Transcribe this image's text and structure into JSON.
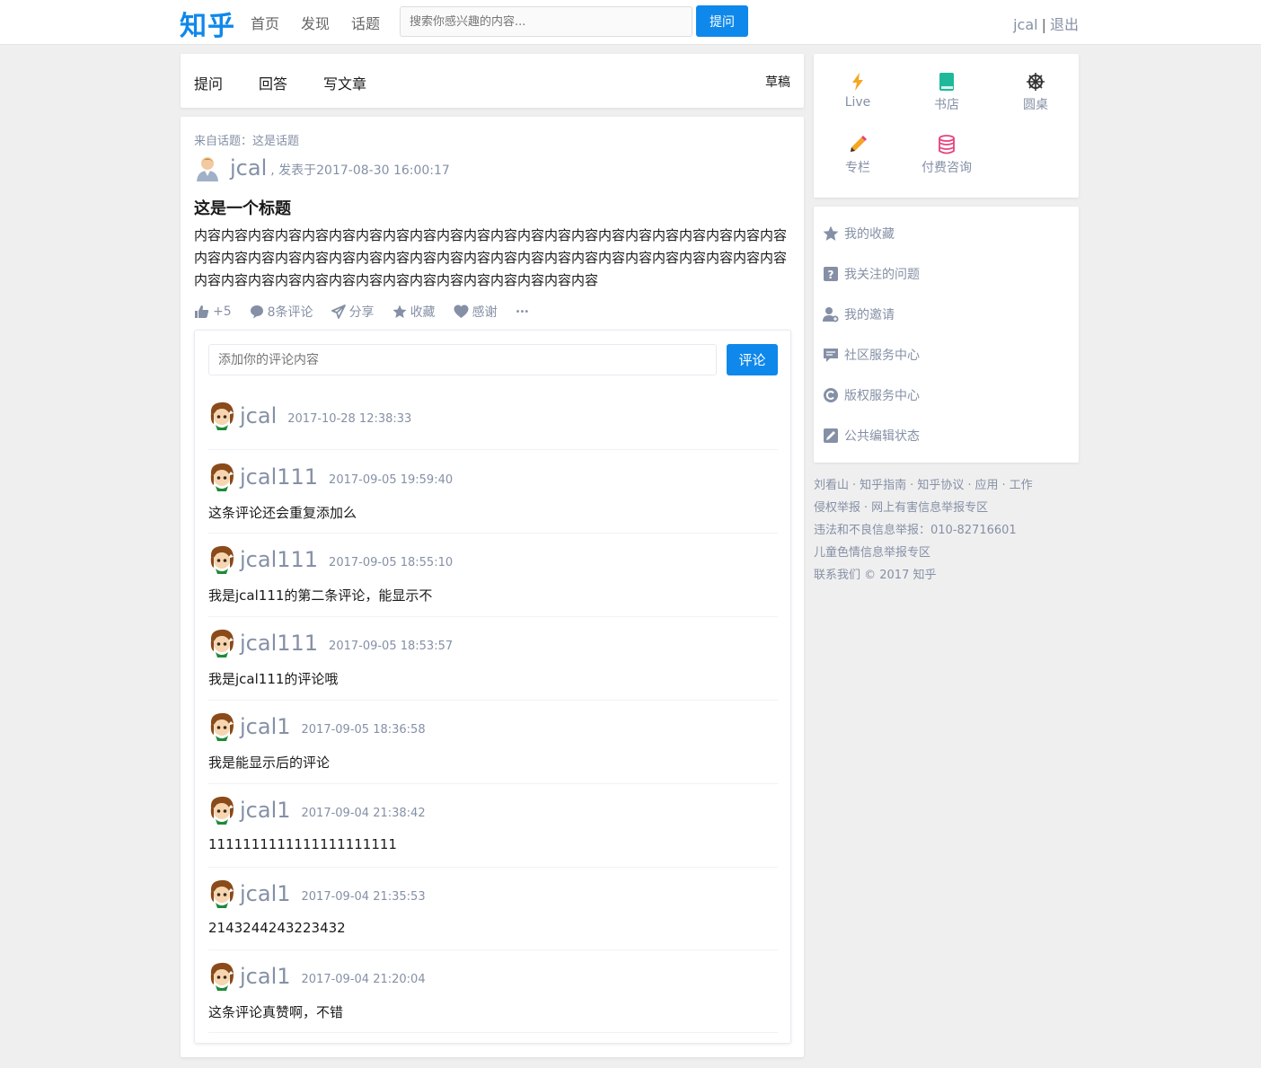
{
  "nav": {
    "logo": "知乎",
    "links": [
      "首页",
      "发现",
      "话题"
    ],
    "search_placeholder": "搜索你感兴趣的内容...",
    "ask_label": "提问",
    "username": "jcal",
    "separator": "|",
    "logout": "退出"
  },
  "write_bar": {
    "items": [
      "提问",
      "回答",
      "写文章"
    ],
    "draft": "草稿"
  },
  "post": {
    "topic_from": "来自话题：这是话题",
    "author": "jcal",
    "published": ", 发表于2017-08-30 16:00:17",
    "title": "这是一个标题",
    "body": "内容内容内容内容内容内容内容内容内容内容内容内容内容内容内容内容内容内容内容内容内容内容内容内容内容内容内容内容内容内容内容内容内容内容内容内容内容内容内容内容内容内容内容内容内容内容内容内容内容内容内容内容内容内容内容内容内容内容内容",
    "actions": {
      "like": "+5",
      "comments": "8条评论",
      "share": "分享",
      "collect": "收藏",
      "thanks": "感谢",
      "more": "•••"
    }
  },
  "comment_form": {
    "placeholder": "添加你的评论内容",
    "submit": "评论"
  },
  "comments": [
    {
      "name": "jcal",
      "time": "2017-10-28 12:38:33",
      "text": ""
    },
    {
      "name": "jcal111",
      "time": "2017-09-05 19:59:40",
      "text": "这条评论还会重复添加么"
    },
    {
      "name": "jcal111",
      "time": "2017-09-05 18:55:10",
      "text": "我是jcal111的第二条评论，能显示不"
    },
    {
      "name": "jcal111",
      "time": "2017-09-05 18:53:57",
      "text": "我是jcal111的评论哦"
    },
    {
      "name": "jcal1",
      "time": "2017-09-05 18:36:58",
      "text": "我是能显示后的评论"
    },
    {
      "name": "jcal1",
      "time": "2017-09-04 21:38:42",
      "text": "1111111111111111111111"
    },
    {
      "name": "jcal1",
      "time": "2017-09-04 21:35:53",
      "text": "2143244243223432"
    },
    {
      "name": "jcal1",
      "time": "2017-09-04 21:20:04",
      "text": "这条评论真赞啊，不错"
    }
  ],
  "apps": [
    {
      "label": "Live",
      "icon": "lightning-icon",
      "color": "#f5a623"
    },
    {
      "label": "书店",
      "icon": "book-icon",
      "color": "#1fb89a"
    },
    {
      "label": "圆桌",
      "icon": "wheel-icon",
      "color": "#333333"
    },
    {
      "label": "专栏",
      "icon": "pencil-icon",
      "color": "#f5a623"
    },
    {
      "label": "付费咨询",
      "icon": "coins-icon",
      "color": "#e8407e"
    }
  ],
  "side_links": [
    {
      "label": "我的收藏",
      "icon": "star-icon"
    },
    {
      "label": "我关注的问题",
      "icon": "question-icon"
    },
    {
      "label": "我的邀请",
      "icon": "invite-icon"
    },
    {
      "label": "社区服务中心",
      "icon": "chat-icon"
    },
    {
      "label": "版权服务中心",
      "icon": "copyright-icon"
    },
    {
      "label": "公共编辑状态",
      "icon": "edit-icon"
    }
  ],
  "footer": {
    "line1": [
      "刘看山",
      "知乎指南",
      "知乎协议",
      "应用",
      "工作"
    ],
    "line2": [
      "侵权举报",
      "网上有害信息举报专区"
    ],
    "line3": "违法和不良信息举报：010-82716601",
    "line4": "儿童色情信息举报专区",
    "line5": "联系我们 © 2017 知乎",
    "dot": "·"
  },
  "colors": {
    "brand": "#0f88eb",
    "muted": "#8590a6",
    "background": "#efefef"
  }
}
